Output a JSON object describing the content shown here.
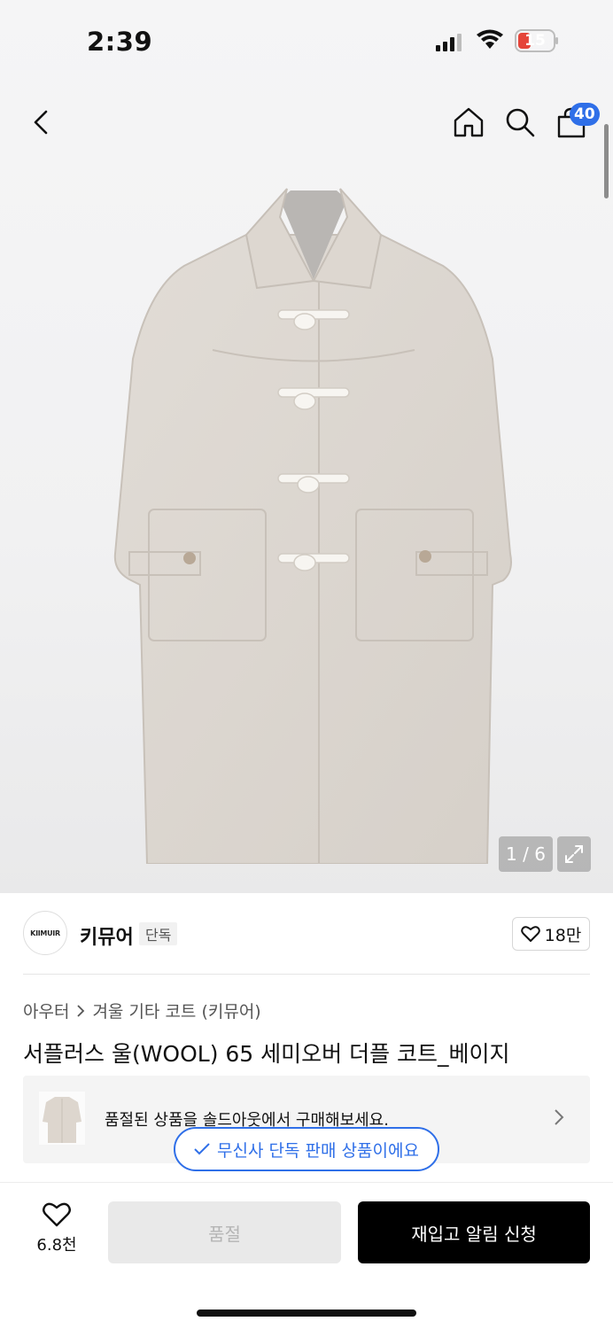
{
  "status_bar": {
    "time": "2:39",
    "battery": "15",
    "battery_color": "#e5453a"
  },
  "nav": {
    "back_icon": "chevron-left-icon",
    "home_icon": "home-icon",
    "search_icon": "search-icon",
    "cart_icon": "shopping-bag-icon",
    "cart_count": "40"
  },
  "gallery": {
    "counter": "1 / 6",
    "expand_icon": "expand-icon"
  },
  "brand": {
    "logo_text": "KIIMUIR",
    "name": "키뮤어",
    "tag": "단독",
    "likes": "18만"
  },
  "product": {
    "breadcrumb": [
      "아우터",
      "겨울 기타 코트 (키뮤어)"
    ],
    "title": "서플러스 울(WOOL) 65 세미오버 더플 코트_베이지"
  },
  "soldout_banner": {
    "message": "품절된 상품을 솔드아웃에서 구매해보세요."
  },
  "toast": {
    "text": "무신사 단독 판매 상품이에요"
  },
  "bottom_bar": {
    "wish_count": "6.8천",
    "soldout_label": "품절",
    "restock_label": "재입고 알림 신청"
  },
  "colors": {
    "accent": "#2f6fe8",
    "primary_button": "#000000",
    "disabled_button": "#e9e9e9"
  }
}
